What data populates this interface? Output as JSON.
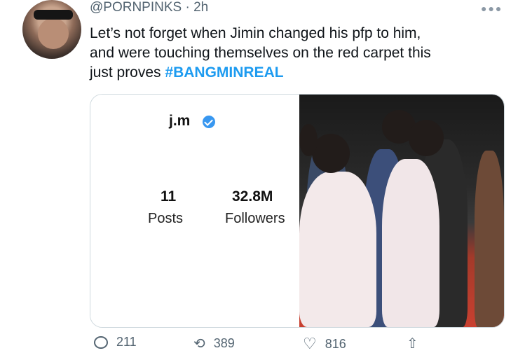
{
  "tweet": {
    "handle": "@PORNPINKS",
    "separator": " · ",
    "time": "2h",
    "text_line1": "Let’s not forget when Jimin changed his pfp to him,",
    "text_line2": "and were touching themselves on the red carpet this",
    "text_line3": "just proves ",
    "hashtag": "#BANGMINREAL"
  },
  "media": {
    "profile_name": "j.m",
    "posts_count": "11",
    "posts_label": "Posts",
    "followers_count": "32.8M",
    "followers_label": "Followers"
  },
  "actions": {
    "reply_count": "211",
    "retweet_count": "389",
    "like_count": "816"
  },
  "icons": {
    "more": "more-horizontal-icon",
    "verified": "verified-badge-icon",
    "reply": "reply-icon",
    "retweet": "retweet-icon",
    "like": "heart-icon",
    "share": "share-icon"
  },
  "colors": {
    "hashtag": "#1d9bf0",
    "verified": "#3897f0",
    "muted": "#536471"
  }
}
